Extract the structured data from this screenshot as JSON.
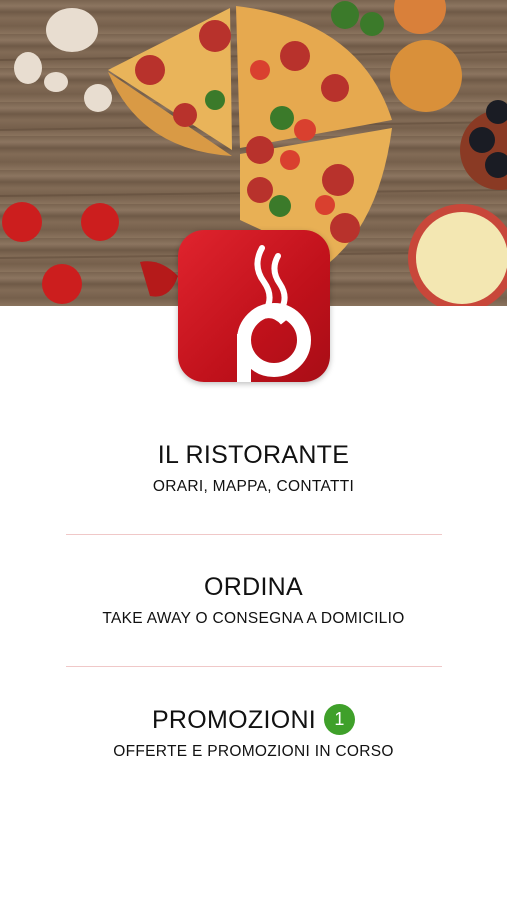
{
  "hero": {
    "image": "pizza-ingredients-photo"
  },
  "logo": {
    "icon": "restaurant-app-logo",
    "color": "#d11a24"
  },
  "menu": {
    "items": [
      {
        "title": "IL RISTORANTE",
        "subtitle": "ORARI, MAPPA, CONTATTI"
      },
      {
        "title": "ORDINA",
        "subtitle": "TAKE AWAY O CONSEGNA A DOMICILIO"
      },
      {
        "title": "PROMOZIONI",
        "subtitle": "OFFERTE E PROMOZIONI IN CORSO",
        "badge": "1"
      }
    ]
  },
  "colors": {
    "accent": "#d11a24",
    "badge": "#3fa02a",
    "divider": "#f0c8c8"
  }
}
